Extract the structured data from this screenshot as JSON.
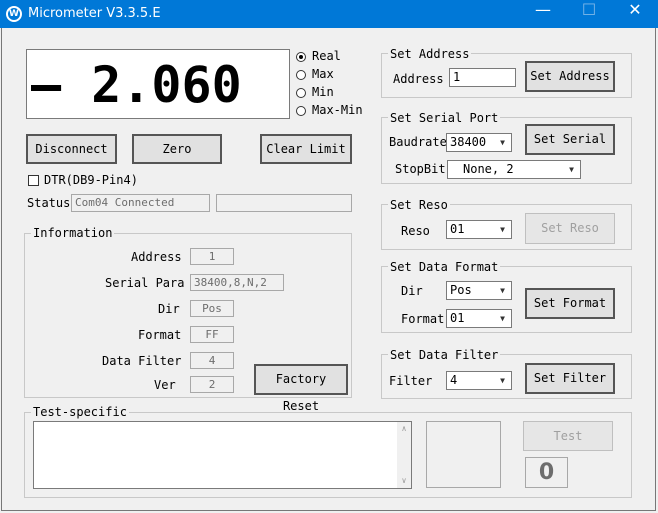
{
  "window": {
    "title": "Micrometer V3.3.5.E",
    "app_icon": "W",
    "minimize": "—",
    "maximize": "☐",
    "close": "✕"
  },
  "readout": {
    "value": "– 2.060"
  },
  "mode": {
    "options": [
      "Real",
      "Max",
      "Min",
      "Max-Min"
    ],
    "selected": "Real"
  },
  "buttons": {
    "disconnect": "Disconnect",
    "zero": "Zero",
    "clear_limit": "Clear Limit",
    "factory_reset": "Factory Reset",
    "test": "Test"
  },
  "dtr": {
    "label": "DTR(DB9-Pin4)",
    "checked": false
  },
  "status": {
    "label": "Status",
    "value": "Com04 Connected",
    "extra": ""
  },
  "information": {
    "title": "Information",
    "address": {
      "label": "Address",
      "value": "1"
    },
    "serial_para": {
      "label": "Serial Para",
      "value": "38400,8,N,2"
    },
    "dir": {
      "label": "Dir",
      "value": "Pos"
    },
    "format": {
      "label": "Format",
      "value": "FF"
    },
    "data_filter": {
      "label": "Data Filter",
      "value": "4"
    },
    "ver": {
      "label": "Ver",
      "value": "2"
    }
  },
  "set_address": {
    "title": "Set Address",
    "label": "Address",
    "value": "1",
    "button": "Set Address"
  },
  "set_serial": {
    "title": "Set Serial Port",
    "baudrate_label": "Baudrate",
    "baudrate": "38400",
    "stopbit_label": "StopBit",
    "stopbit": "None, 2",
    "button": "Set Serial"
  },
  "set_reso": {
    "title": "Set Reso",
    "label": "Reso",
    "value": "01",
    "button": "Set Reso"
  },
  "set_format": {
    "title": "Set Data Format",
    "dir_label": "Dir",
    "dir": "Pos",
    "format_label": "Format",
    "format": "01",
    "button": "Set Format"
  },
  "set_filter": {
    "title": "Set Data Filter",
    "label": "Filter",
    "value": "4",
    "button": "Set Filter"
  },
  "test": {
    "title": "Test-specific",
    "counter": "0",
    "output": ""
  },
  "colors": {
    "titlebar": "#0078d7",
    "background": "#f0f0f0"
  }
}
